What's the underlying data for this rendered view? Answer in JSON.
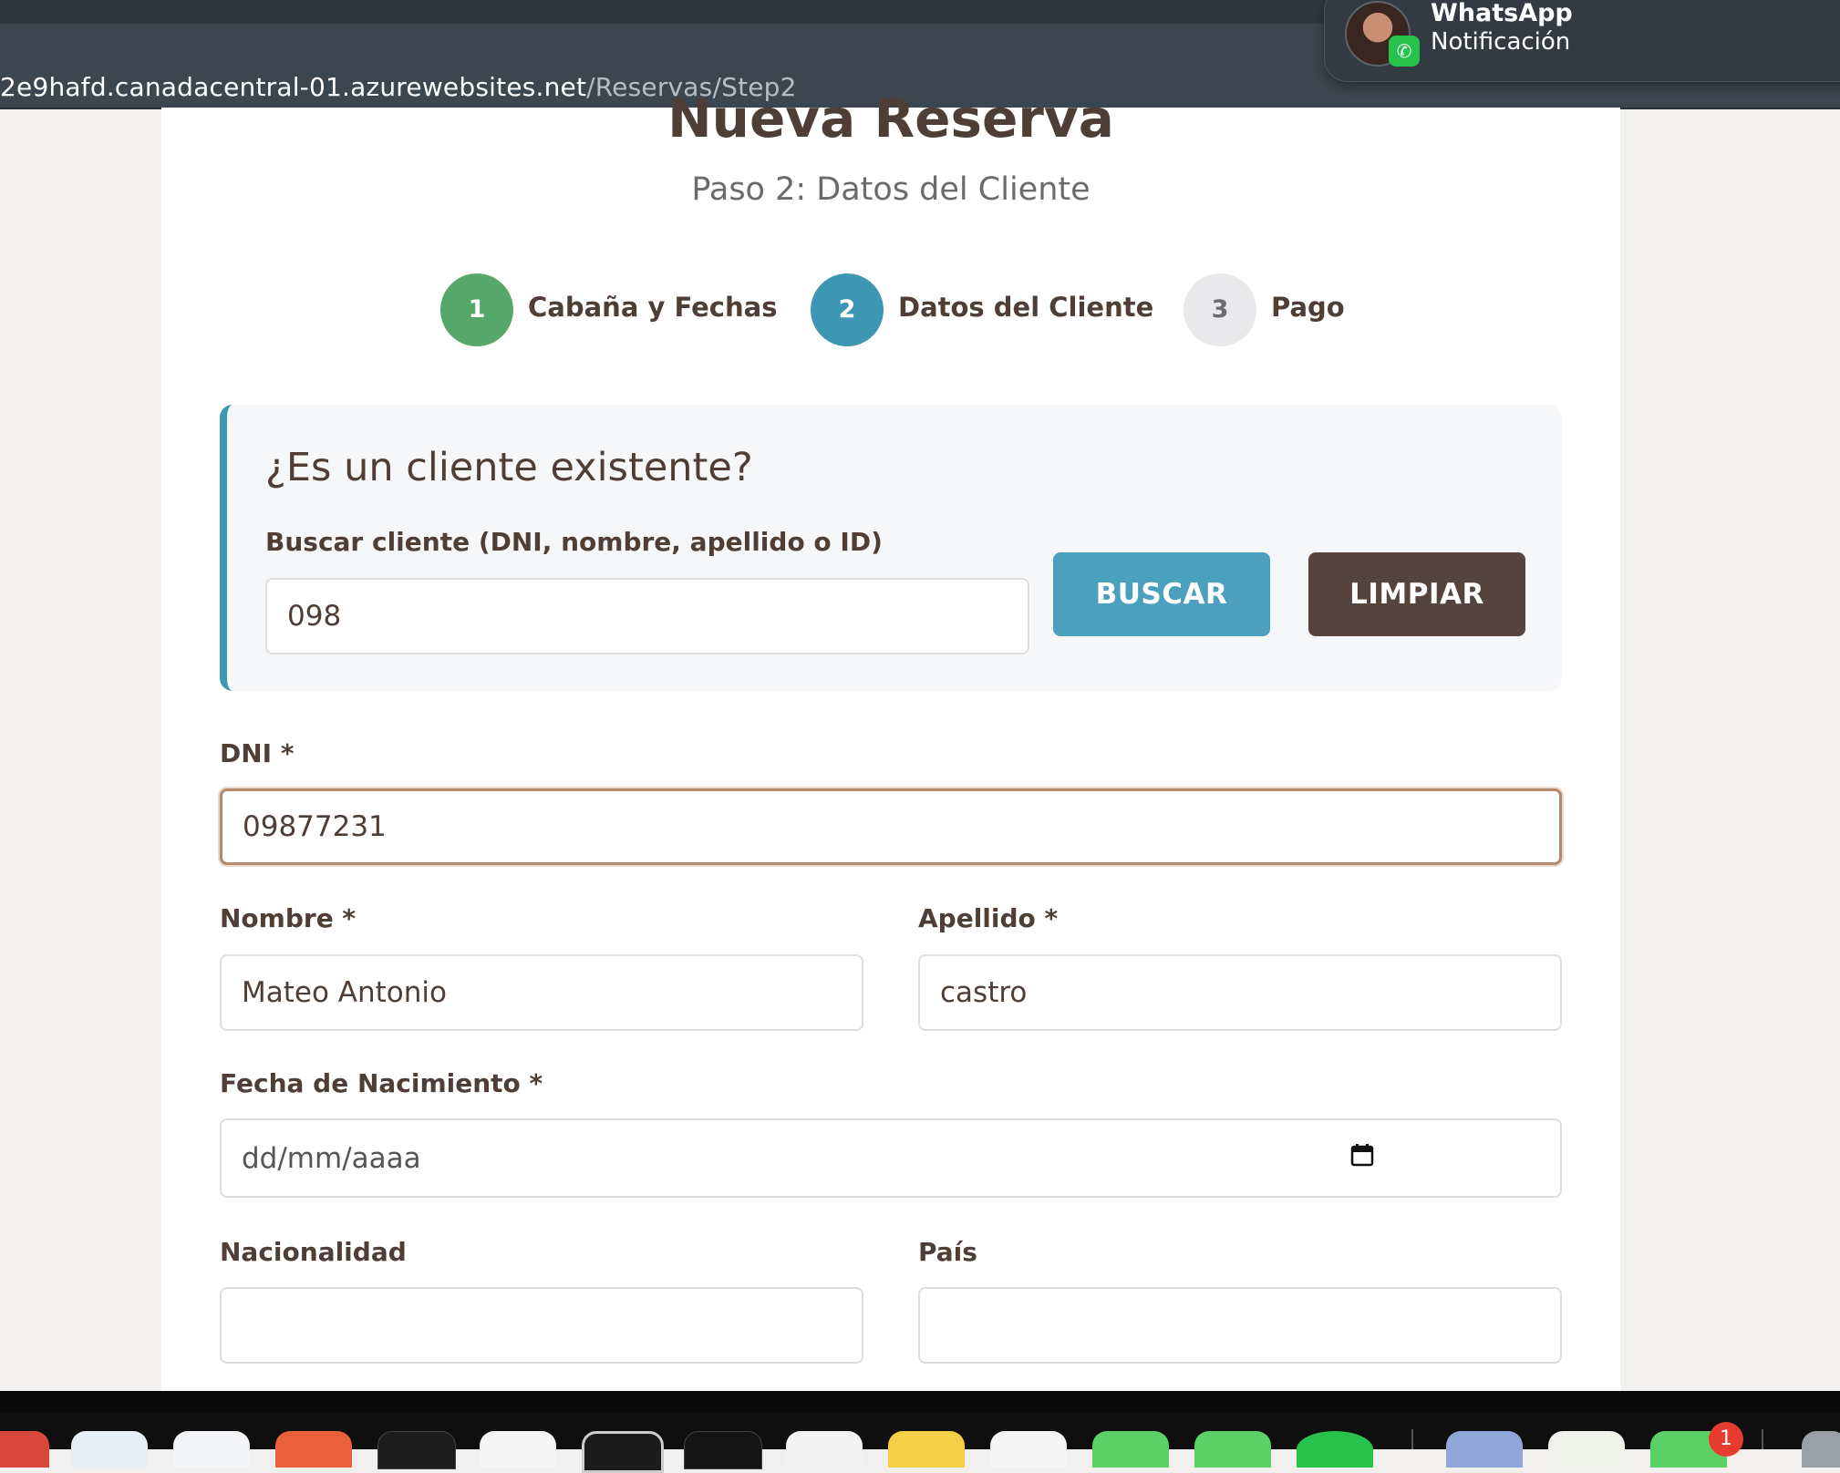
{
  "browser": {
    "url_host": "2e9hafd.canadacentral-01.azurewebsites.net",
    "url_path": "/Reservas/Step2"
  },
  "notification": {
    "app": "WhatsApp",
    "text": "Notificación",
    "badge_icon": "whatsapp-icon"
  },
  "page": {
    "title": "Nueva Reserva",
    "subtitle": "Paso 2: Datos del Cliente"
  },
  "steps": [
    {
      "number": "1",
      "label": "Cabaña y Fechas",
      "state": "completed",
      "color": "#55a869"
    },
    {
      "number": "2",
      "label": "Datos del Cliente",
      "state": "active",
      "color": "#3d97b2"
    },
    {
      "number": "3",
      "label": "Pago",
      "state": "pending",
      "color": "#e9e9ec"
    }
  ],
  "search": {
    "title": "¿Es un cliente existente?",
    "label": "Buscar cliente (DNI, nombre, apellido o ID)",
    "value": "098",
    "search_button": "BUSCAR",
    "clear_button": "LIMPIAR"
  },
  "form": {
    "dni": {
      "label": "DNI *",
      "value": "09877231"
    },
    "nombre": {
      "label": "Nombre *",
      "value": "Mateo Antonio"
    },
    "apellido": {
      "label": "Apellido *",
      "value": "castro"
    },
    "fecha_nacimiento": {
      "label": "Fecha de Nacimiento *",
      "placeholder": "dd/mm/aaaa",
      "icon": "calendar-icon"
    },
    "nacionalidad": {
      "label": "Nacionalidad",
      "value": ""
    },
    "pais": {
      "label": "País",
      "value": ""
    }
  },
  "dock": {
    "badge_count": "1"
  },
  "colors": {
    "accent": "#3d97b2",
    "primary_dark": "#54443d",
    "success": "#55a869"
  }
}
